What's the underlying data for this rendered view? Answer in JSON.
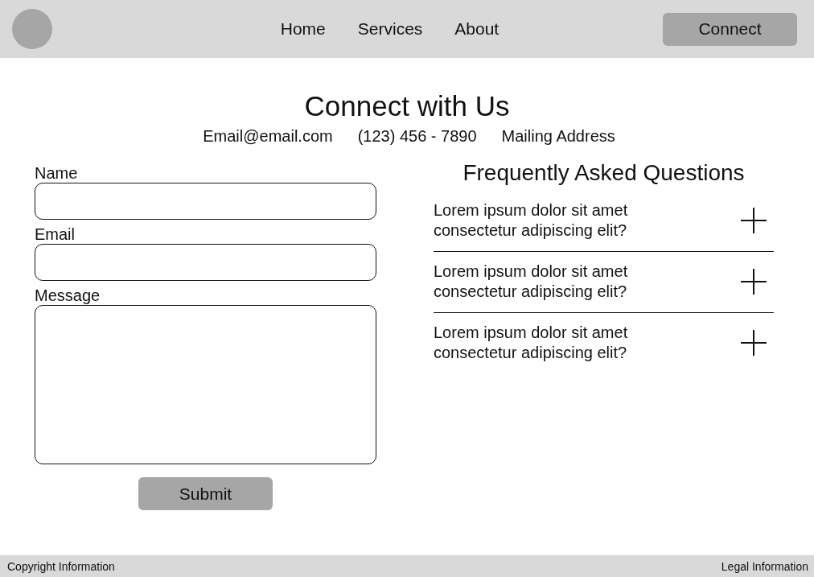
{
  "header": {
    "nav": [
      {
        "label": "Home"
      },
      {
        "label": "Services"
      },
      {
        "label": "About"
      }
    ],
    "cta": "Connect"
  },
  "contact": {
    "title": "Connect with Us",
    "details": [
      "Email@email.com",
      "(123) 456 - 7890",
      "Mailing Address"
    ]
  },
  "form": {
    "fields": [
      {
        "label": "Name",
        "kind": "input"
      },
      {
        "label": "Email",
        "kind": "input"
      },
      {
        "label": "Message",
        "kind": "textarea"
      }
    ],
    "submit": "Submit"
  },
  "faq": {
    "title": "Frequently Asked Questions",
    "items": [
      {
        "question": "Lorem ipsum dolor sit amet consectetur adipiscing elit?",
        "expanded": false
      },
      {
        "question": "Lorem ipsum dolor sit amet consectetur adipiscing elit?",
        "expanded": false
      },
      {
        "question": "Lorem ipsum dolor sit amet consectetur adipiscing elit?",
        "expanded": false
      }
    ]
  },
  "footer": {
    "left": "Copyright Information",
    "right": "Legal Information"
  }
}
